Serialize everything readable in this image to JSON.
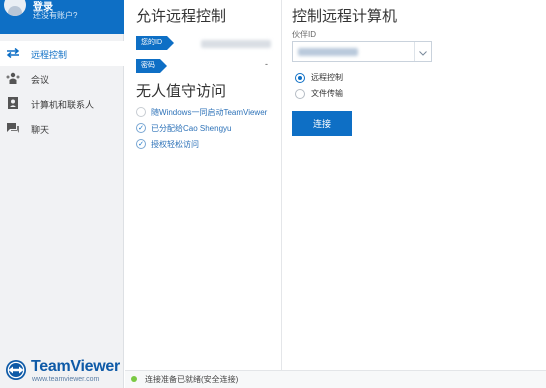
{
  "sidebar": {
    "profile": {
      "login": "登录",
      "subtitle": "还没有账户?"
    },
    "items": [
      {
        "label": "远程控制",
        "icon": "arrows-icon",
        "active": true
      },
      {
        "label": "会议",
        "icon": "meeting-icon",
        "active": false
      },
      {
        "label": "计算机和联系人",
        "icon": "contacts-icon",
        "active": false
      },
      {
        "label": "聊天",
        "icon": "chat-icon",
        "active": false
      }
    ],
    "brand": {
      "name": "TeamViewer",
      "url": "www.teamviewer.com"
    }
  },
  "allow": {
    "title": "允许远程控制",
    "id_label": "您的ID",
    "password_label": "密码",
    "password_value": "-",
    "unattended_title": "无人值守访问",
    "options": [
      {
        "label": "随Windows一同启动TeamViewer",
        "checked": false
      },
      {
        "label": "已分配给Cao Shengyu",
        "checked": true
      },
      {
        "label": "授权轻松访问",
        "checked": true
      }
    ]
  },
  "control": {
    "title": "控制远程计算机",
    "partner_label": "伙伴ID",
    "modes": [
      {
        "label": "远程控制",
        "selected": true
      },
      {
        "label": "文件传输",
        "selected": false
      }
    ],
    "connect_label": "连接"
  },
  "status": {
    "text": "连接准备已就绪(安全连接)",
    "color": "#7ac943"
  },
  "colors": {
    "accent": "#0e6fc5"
  }
}
